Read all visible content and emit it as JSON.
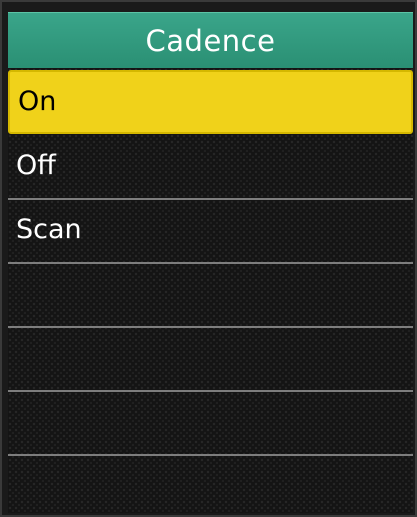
{
  "header": {
    "title": "Cadence"
  },
  "menu": {
    "items": [
      {
        "label": "On",
        "selected": true
      },
      {
        "label": "Off",
        "selected": false
      },
      {
        "label": "Scan",
        "selected": false
      },
      {
        "label": "",
        "selected": false
      },
      {
        "label": "",
        "selected": false
      },
      {
        "label": "",
        "selected": false
      }
    ]
  },
  "colors": {
    "header_bg": "#2f9a7e",
    "selection": "#f0d21a",
    "background": "#141414",
    "text": "#ffffff"
  }
}
